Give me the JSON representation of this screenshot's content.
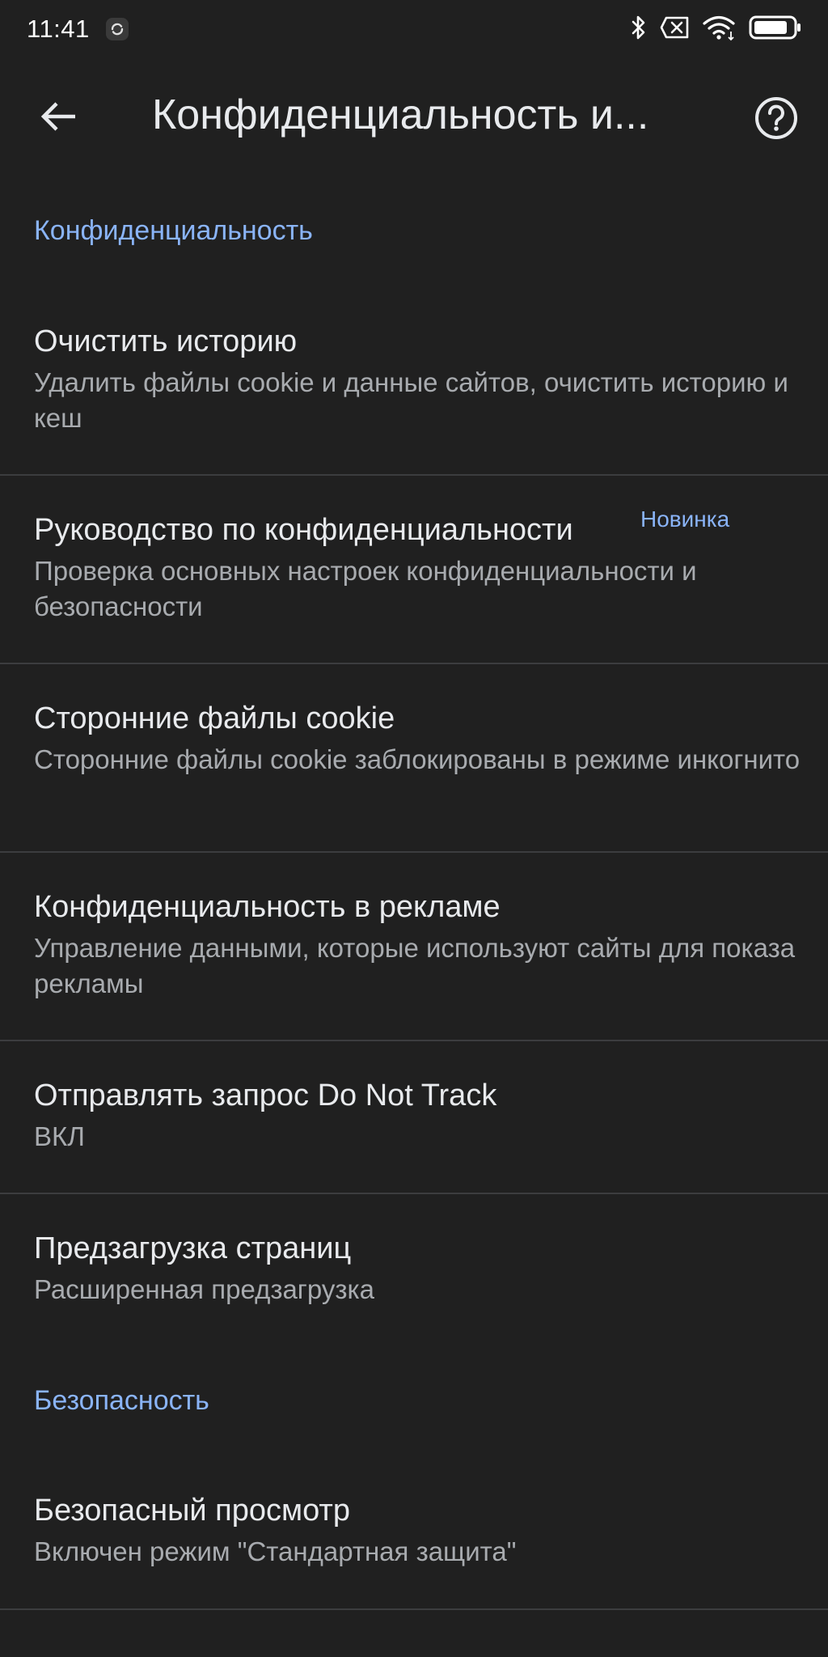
{
  "status_bar": {
    "time": "11:41",
    "icons": [
      "sync-icon",
      "bluetooth-icon",
      "no-sim-icon",
      "wifi-icon",
      "battery-icon"
    ]
  },
  "app_bar": {
    "title": "Конфиденциальность и...",
    "back_icon": "back-arrow-icon",
    "help_icon": "help-icon"
  },
  "sections": {
    "privacy": {
      "header": "Конфиденциальность",
      "items": [
        {
          "title": "Очистить историю",
          "subtitle": "Удалить файлы cookie и данные сайтов, очистить историю и кеш"
        },
        {
          "title": "Руководство по конфиденциальности",
          "badge": "Новинка",
          "subtitle": "Проверка основных настроек конфиденциальности и безопасности"
        },
        {
          "title": "Сторонние файлы cookie",
          "subtitle": "Сторонние файлы cookie заблокированы в режиме инкогнито"
        },
        {
          "title": "Конфиденциальность в рекламе",
          "subtitle": "Управление данными, которые используют сайты для показа рекламы"
        },
        {
          "title": "Отправлять запрос Do Not Track",
          "subtitle": "ВКЛ"
        },
        {
          "title": "Предзагрузка страниц",
          "subtitle": "Расширенная предзагрузка"
        }
      ]
    },
    "security": {
      "header": "Безопасность",
      "items": [
        {
          "title": "Безопасный просмотр",
          "subtitle": "Включен режим \"Стандартная защита\""
        }
      ]
    }
  },
  "colors": {
    "background": "#202020",
    "accent": "#8ab4f8",
    "title_text": "#e8eaed",
    "secondary_text": "#a8abaf",
    "divider": "#3c3d3f"
  }
}
